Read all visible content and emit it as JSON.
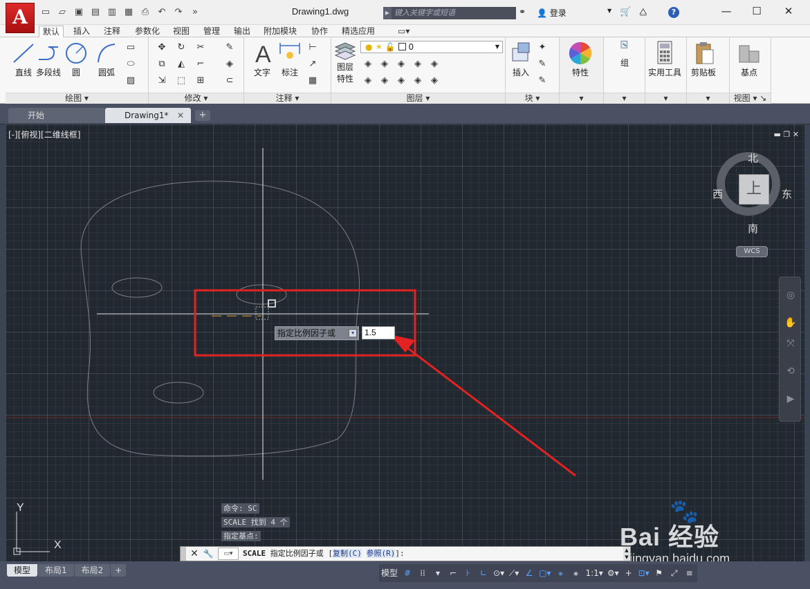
{
  "titlebar": {
    "document_title": "Drawing1.dwg",
    "logo_letter": "A",
    "search_placeholder": "键入关键字或短语",
    "login_label": "登录"
  },
  "ribbon_tabs": [
    "默认",
    "插入",
    "注释",
    "参数化",
    "视图",
    "管理",
    "输出",
    "附加模块",
    "协作",
    "精选应用"
  ],
  "ribbon": {
    "draw": {
      "line": "直线",
      "polyline": "多段线",
      "circle": "圆",
      "arc": "圆弧",
      "footer": "绘图"
    },
    "modify": {
      "footer": "修改"
    },
    "annotation": {
      "text": "文字",
      "dimension": "标注",
      "footer": "注释"
    },
    "layers": {
      "properties_line1": "图层",
      "properties_line2": "特性",
      "current_layer": "0",
      "footer": "图层"
    },
    "block": {
      "insert": "插入",
      "footer": "块"
    },
    "properties": {
      "label": "特性"
    },
    "groups": {
      "label": "组"
    },
    "utilities": {
      "label": "实用工具"
    },
    "clipboard": {
      "label": "剪贴板"
    },
    "view": {
      "basepoint": "基点",
      "footer": "视图"
    }
  },
  "file_tabs": [
    {
      "label": "开始"
    },
    {
      "label": "Drawing1*"
    }
  ],
  "viewport": {
    "label": "[-][俯视][二维线框]",
    "viewcube": {
      "north": "北",
      "south": "南",
      "east": "东",
      "west": "西",
      "top": "上"
    },
    "wcs": "WCS"
  },
  "dynamic_input": {
    "prompt": "指定比例因子或",
    "value": "1.5"
  },
  "command_history": [
    "命令: SC",
    "SCALE 找到 4 个",
    "指定基点:"
  ],
  "command_line": {
    "command": "SCALE",
    "prompt": "指定比例因子或 [",
    "option1": "复制(C)",
    "option2": "参照(R)",
    "suffix": "]:"
  },
  "ucs": {
    "x": "X",
    "y": "Y"
  },
  "layout_tabs": [
    "模型",
    "布局1",
    "布局2"
  ],
  "status": {
    "model": "模型",
    "scale": "1:1"
  },
  "watermark": {
    "main": "Bai 经验",
    "sub": "jingyan.baidu.com"
  },
  "colors": {
    "canvas_bg": "#212830",
    "highlight_box": "#e32222",
    "accent_blue": "#55a4ff"
  }
}
